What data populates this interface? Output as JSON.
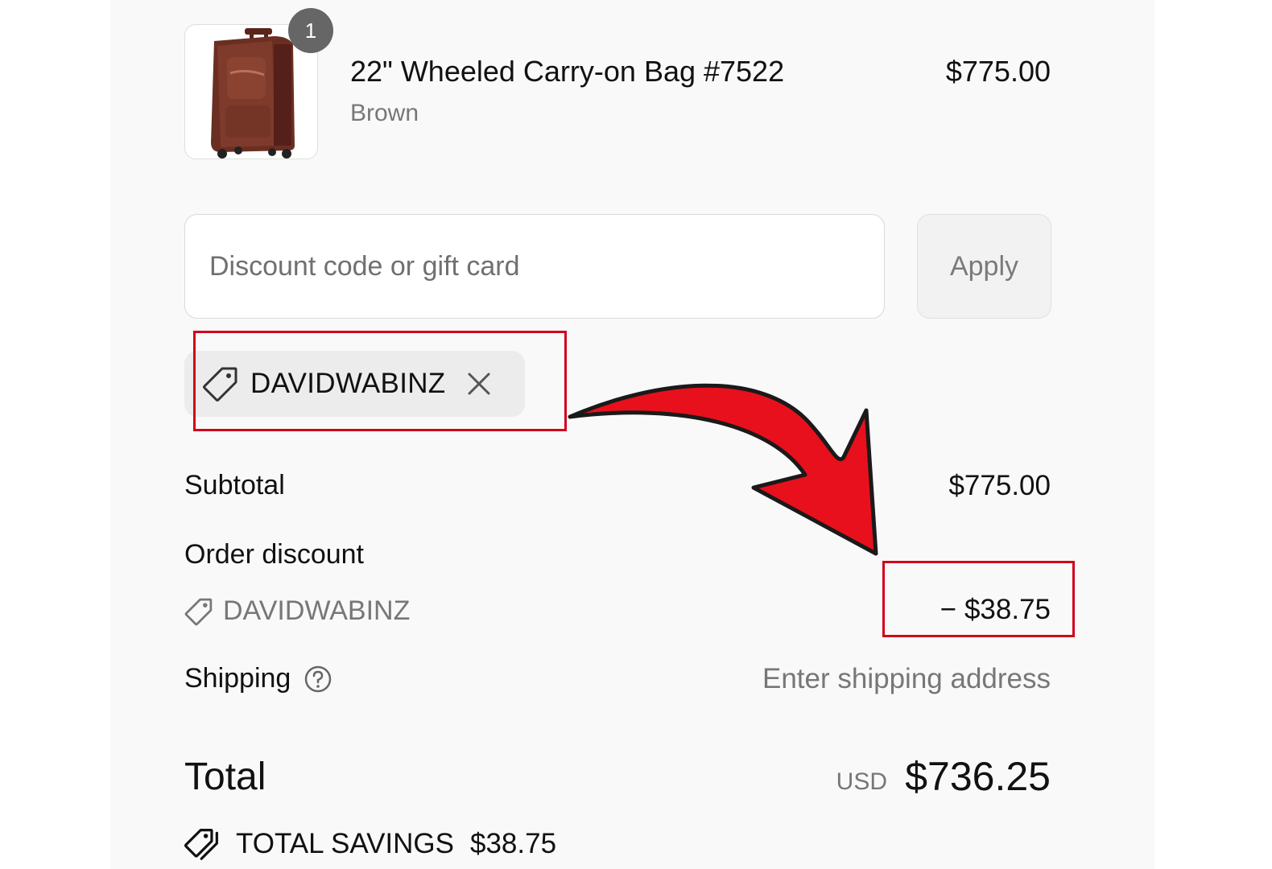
{
  "item": {
    "quantity": "1",
    "title": "22\" Wheeled Carry-on Bag #7522",
    "variant": "Brown",
    "price": "$775.00",
    "image_icon": "rolling-suitcase-icon",
    "image_color": "#6b2e22"
  },
  "discount": {
    "placeholder": "Discount code or gift card",
    "apply_label": "Apply",
    "applied_code": "DAVIDWABINZ"
  },
  "summary": {
    "subtotal_label": "Subtotal",
    "subtotal_value": "$775.00",
    "order_discount_label": "Order discount",
    "order_discount_code": "DAVIDWABINZ",
    "order_discount_value": "− $38.75",
    "shipping_label": "Shipping",
    "shipping_value": "Enter shipping address",
    "total_label": "Total",
    "currency": "USD",
    "total_value": "$736.25",
    "savings_label": "TOTAL SAVINGS",
    "savings_value": "$38.75"
  },
  "annotation": {
    "highlight_color": "#d0021b",
    "arrow_color": "#e8101c"
  }
}
